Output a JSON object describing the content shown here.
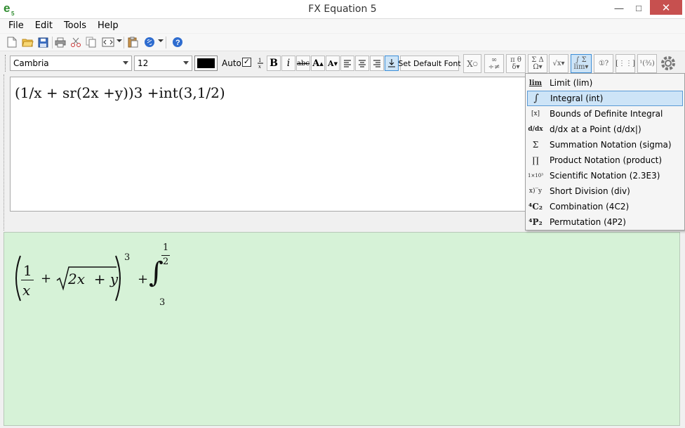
{
  "window": {
    "title": "FX Equation 5",
    "min_glyph": "—",
    "max_glyph": "□",
    "close_glyph": "✕"
  },
  "menu": [
    "File",
    "Edit",
    "Tools",
    "Help"
  ],
  "format_toolbar": {
    "font": "Cambria",
    "size": "12",
    "auto_label": "Auto",
    "auto_checked": "✓",
    "set_default_font": "Set Default Font"
  },
  "editor": {
    "text": "(1/x + sr(2x +y))3 +int(3,1/2)"
  },
  "render": {
    "frac_num": "1",
    "frac_den": "x",
    "plus1": "+",
    "sqrt_content": "2x  + y",
    "exponent": "3",
    "plus2": "+",
    "integral_sign": "∫",
    "int_upper_num": "1",
    "int_upper_den": "2",
    "int_lower": "3"
  },
  "dropdown": {
    "items": [
      {
        "icon": "lim",
        "label": "Limit (lim)"
      },
      {
        "icon": "∫",
        "label": "Integral (int)",
        "selected": true
      },
      {
        "icon": "[x]",
        "label": "Bounds of Definite Integral"
      },
      {
        "icon": "d/dx",
        "label": "d/dx at a Point (d/dx|)"
      },
      {
        "icon": "Σ",
        "label": "Summation Notation (sigma)"
      },
      {
        "icon": "∏",
        "label": "Product Notation (product)"
      },
      {
        "icon": "1×10³",
        "label": "Scientific Notation (2.3E3)"
      },
      {
        "icon": "x)‾y",
        "label": "Short Division (div)"
      },
      {
        "icon": "⁴C₂",
        "label": "Combination (4C2)"
      },
      {
        "icon": "⁴P₂",
        "label": "Permutation (4P2)"
      }
    ]
  },
  "colors": {
    "render_bg": "#d6f2d7",
    "selected_bg": "#cde4f7",
    "close_btn": "#c7504f",
    "font_color": "#000000"
  }
}
